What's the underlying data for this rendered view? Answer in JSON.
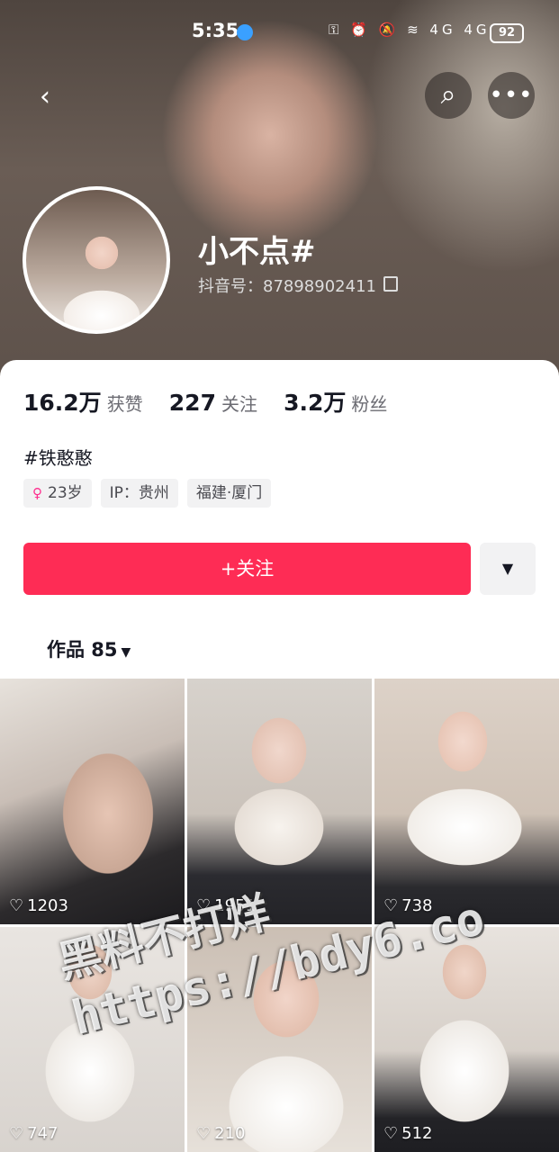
{
  "status_bar": {
    "time": "5:35",
    "icons_text": "⚿ ⏰ 🔕 ≋ 4G 4G",
    "battery": "92"
  },
  "nav": {
    "back_icon": "‹",
    "search_icon": "⌕",
    "more_icon": "•••"
  },
  "profile": {
    "name": "小不点#",
    "douyin_id": "抖音号：87898902411"
  },
  "stats": {
    "likes_num": "16.2万",
    "likes_label": "获赞",
    "following_num": "227",
    "following_label": "关注",
    "followers_num": "3.2万",
    "followers_label": "粉丝"
  },
  "bio": "#铁憨憨",
  "tags": {
    "gender_icon": "♀",
    "age": "23岁",
    "ip": "IP：贵州",
    "location": "福建·厦门"
  },
  "actions": {
    "follow_label": "+关注",
    "dropdown_icon": "▼"
  },
  "works": {
    "label": "作品 85",
    "caret": "▼"
  },
  "videos": [
    {
      "likes": "1203"
    },
    {
      "likes": "1951"
    },
    {
      "likes": "738"
    },
    {
      "likes": "747"
    },
    {
      "likes": "210"
    },
    {
      "likes": "512"
    }
  ],
  "heart_icon": "♡",
  "watermark": {
    "line1": "黑料不打烊",
    "line2": "https://bdy6.co"
  }
}
